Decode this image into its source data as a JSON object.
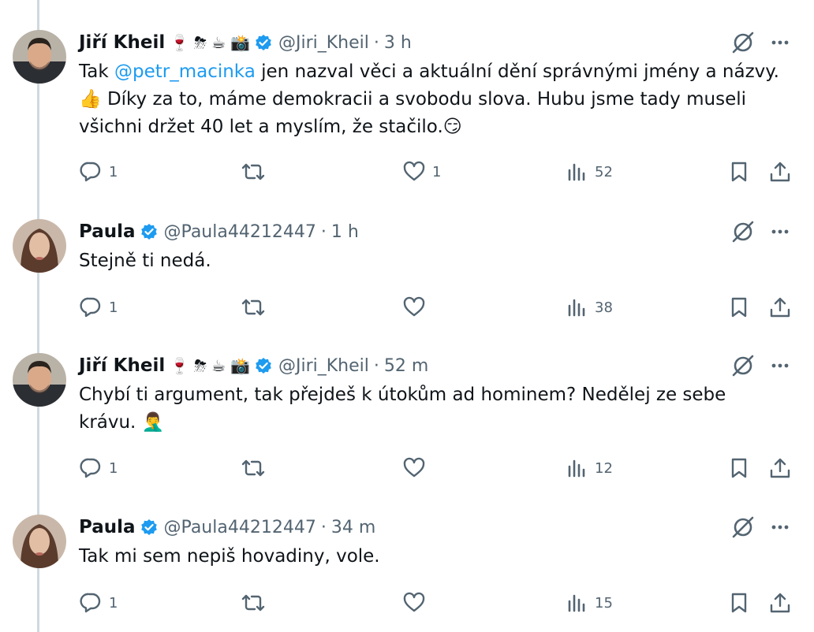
{
  "tweets": [
    {
      "author": "Jiří Kheil",
      "badges": [
        "🍷",
        "⛈",
        "☕",
        "📸"
      ],
      "handle": "@Jiri_Kheil",
      "separator": "·",
      "time": "3 h",
      "text_before": "Tak ",
      "mention": "@petr_macinka",
      "text_after": " jen nazval věci a aktuální dění správnými jmény a názvy.",
      "line2_emoji": "👍",
      "line2": " Díky za to, máme demokracii a svobodu slova. Hubu jsme tady museli",
      "line3": "všichni držet 40 let a myslím, že stačilo.",
      "line3_emoji": "😏",
      "counts": {
        "replies": "1",
        "likes": "1",
        "views": "52"
      }
    },
    {
      "author": "Paula",
      "handle": "@Paula44212447",
      "separator": "·",
      "time": "1 h",
      "text": "Stejně ti nedá.",
      "counts": {
        "replies": "1",
        "views": "38"
      }
    },
    {
      "author": "Jiří Kheil",
      "badges": [
        "🍷",
        "⛈",
        "☕",
        "📸"
      ],
      "handle": "@Jiri_Kheil",
      "separator": "·",
      "time": "52 m",
      "line1": "Chybí ti argument, tak přejdeš k útokům ad hominem? Nedělej ze sebe",
      "line2": "krávu. ",
      "line2_emoji": "🤦‍♂️",
      "counts": {
        "replies": "1",
        "views": "12"
      }
    },
    {
      "author": "Paula",
      "handle": "@Paula44212447",
      "separator": "·",
      "time": "34 m",
      "text": "Tak mi sem nepiš hovadiny, vole.",
      "counts": {
        "replies": "1",
        "views": "15"
      }
    }
  ],
  "colors": {
    "accent": "#1d9bf0",
    "muted": "#536471",
    "thread": "#cfd9de"
  },
  "icons": [
    "verified-badge-icon",
    "grok-icon",
    "more-icon",
    "reply-icon",
    "retweet-icon",
    "like-icon",
    "views-icon",
    "bookmark-icon",
    "share-icon"
  ]
}
